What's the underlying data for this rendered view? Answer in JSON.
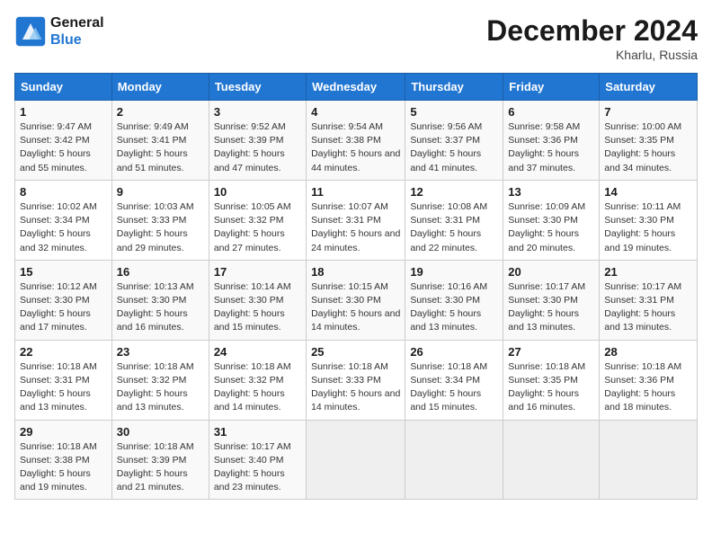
{
  "header": {
    "logo_line1": "General",
    "logo_line2": "Blue",
    "month_title": "December 2024",
    "location": "Kharlu, Russia"
  },
  "days_of_week": [
    "Sunday",
    "Monday",
    "Tuesday",
    "Wednesday",
    "Thursday",
    "Friday",
    "Saturday"
  ],
  "weeks": [
    [
      {
        "day": "1",
        "info": "Sunrise: 9:47 AM\nSunset: 3:42 PM\nDaylight: 5 hours and 55 minutes."
      },
      {
        "day": "2",
        "info": "Sunrise: 9:49 AM\nSunset: 3:41 PM\nDaylight: 5 hours and 51 minutes."
      },
      {
        "day": "3",
        "info": "Sunrise: 9:52 AM\nSunset: 3:39 PM\nDaylight: 5 hours and 47 minutes."
      },
      {
        "day": "4",
        "info": "Sunrise: 9:54 AM\nSunset: 3:38 PM\nDaylight: 5 hours and 44 minutes."
      },
      {
        "day": "5",
        "info": "Sunrise: 9:56 AM\nSunset: 3:37 PM\nDaylight: 5 hours and 41 minutes."
      },
      {
        "day": "6",
        "info": "Sunrise: 9:58 AM\nSunset: 3:36 PM\nDaylight: 5 hours and 37 minutes."
      },
      {
        "day": "7",
        "info": "Sunrise: 10:00 AM\nSunset: 3:35 PM\nDaylight: 5 hours and 34 minutes."
      }
    ],
    [
      {
        "day": "8",
        "info": "Sunrise: 10:02 AM\nSunset: 3:34 PM\nDaylight: 5 hours and 32 minutes."
      },
      {
        "day": "9",
        "info": "Sunrise: 10:03 AM\nSunset: 3:33 PM\nDaylight: 5 hours and 29 minutes."
      },
      {
        "day": "10",
        "info": "Sunrise: 10:05 AM\nSunset: 3:32 PM\nDaylight: 5 hours and 27 minutes."
      },
      {
        "day": "11",
        "info": "Sunrise: 10:07 AM\nSunset: 3:31 PM\nDaylight: 5 hours and 24 minutes."
      },
      {
        "day": "12",
        "info": "Sunrise: 10:08 AM\nSunset: 3:31 PM\nDaylight: 5 hours and 22 minutes."
      },
      {
        "day": "13",
        "info": "Sunrise: 10:09 AM\nSunset: 3:30 PM\nDaylight: 5 hours and 20 minutes."
      },
      {
        "day": "14",
        "info": "Sunrise: 10:11 AM\nSunset: 3:30 PM\nDaylight: 5 hours and 19 minutes."
      }
    ],
    [
      {
        "day": "15",
        "info": "Sunrise: 10:12 AM\nSunset: 3:30 PM\nDaylight: 5 hours and 17 minutes."
      },
      {
        "day": "16",
        "info": "Sunrise: 10:13 AM\nSunset: 3:30 PM\nDaylight: 5 hours and 16 minutes."
      },
      {
        "day": "17",
        "info": "Sunrise: 10:14 AM\nSunset: 3:30 PM\nDaylight: 5 hours and 15 minutes."
      },
      {
        "day": "18",
        "info": "Sunrise: 10:15 AM\nSunset: 3:30 PM\nDaylight: 5 hours and 14 minutes."
      },
      {
        "day": "19",
        "info": "Sunrise: 10:16 AM\nSunset: 3:30 PM\nDaylight: 5 hours and 13 minutes."
      },
      {
        "day": "20",
        "info": "Sunrise: 10:17 AM\nSunset: 3:30 PM\nDaylight: 5 hours and 13 minutes."
      },
      {
        "day": "21",
        "info": "Sunrise: 10:17 AM\nSunset: 3:31 PM\nDaylight: 5 hours and 13 minutes."
      }
    ],
    [
      {
        "day": "22",
        "info": "Sunrise: 10:18 AM\nSunset: 3:31 PM\nDaylight: 5 hours and 13 minutes."
      },
      {
        "day": "23",
        "info": "Sunrise: 10:18 AM\nSunset: 3:32 PM\nDaylight: 5 hours and 13 minutes."
      },
      {
        "day": "24",
        "info": "Sunrise: 10:18 AM\nSunset: 3:32 PM\nDaylight: 5 hours and 14 minutes."
      },
      {
        "day": "25",
        "info": "Sunrise: 10:18 AM\nSunset: 3:33 PM\nDaylight: 5 hours and 14 minutes."
      },
      {
        "day": "26",
        "info": "Sunrise: 10:18 AM\nSunset: 3:34 PM\nDaylight: 5 hours and 15 minutes."
      },
      {
        "day": "27",
        "info": "Sunrise: 10:18 AM\nSunset: 3:35 PM\nDaylight: 5 hours and 16 minutes."
      },
      {
        "day": "28",
        "info": "Sunrise: 10:18 AM\nSunset: 3:36 PM\nDaylight: 5 hours and 18 minutes."
      }
    ],
    [
      {
        "day": "29",
        "info": "Sunrise: 10:18 AM\nSunset: 3:38 PM\nDaylight: 5 hours and 19 minutes."
      },
      {
        "day": "30",
        "info": "Sunrise: 10:18 AM\nSunset: 3:39 PM\nDaylight: 5 hours and 21 minutes."
      },
      {
        "day": "31",
        "info": "Sunrise: 10:17 AM\nSunset: 3:40 PM\nDaylight: 5 hours and 23 minutes."
      },
      null,
      null,
      null,
      null
    ]
  ]
}
